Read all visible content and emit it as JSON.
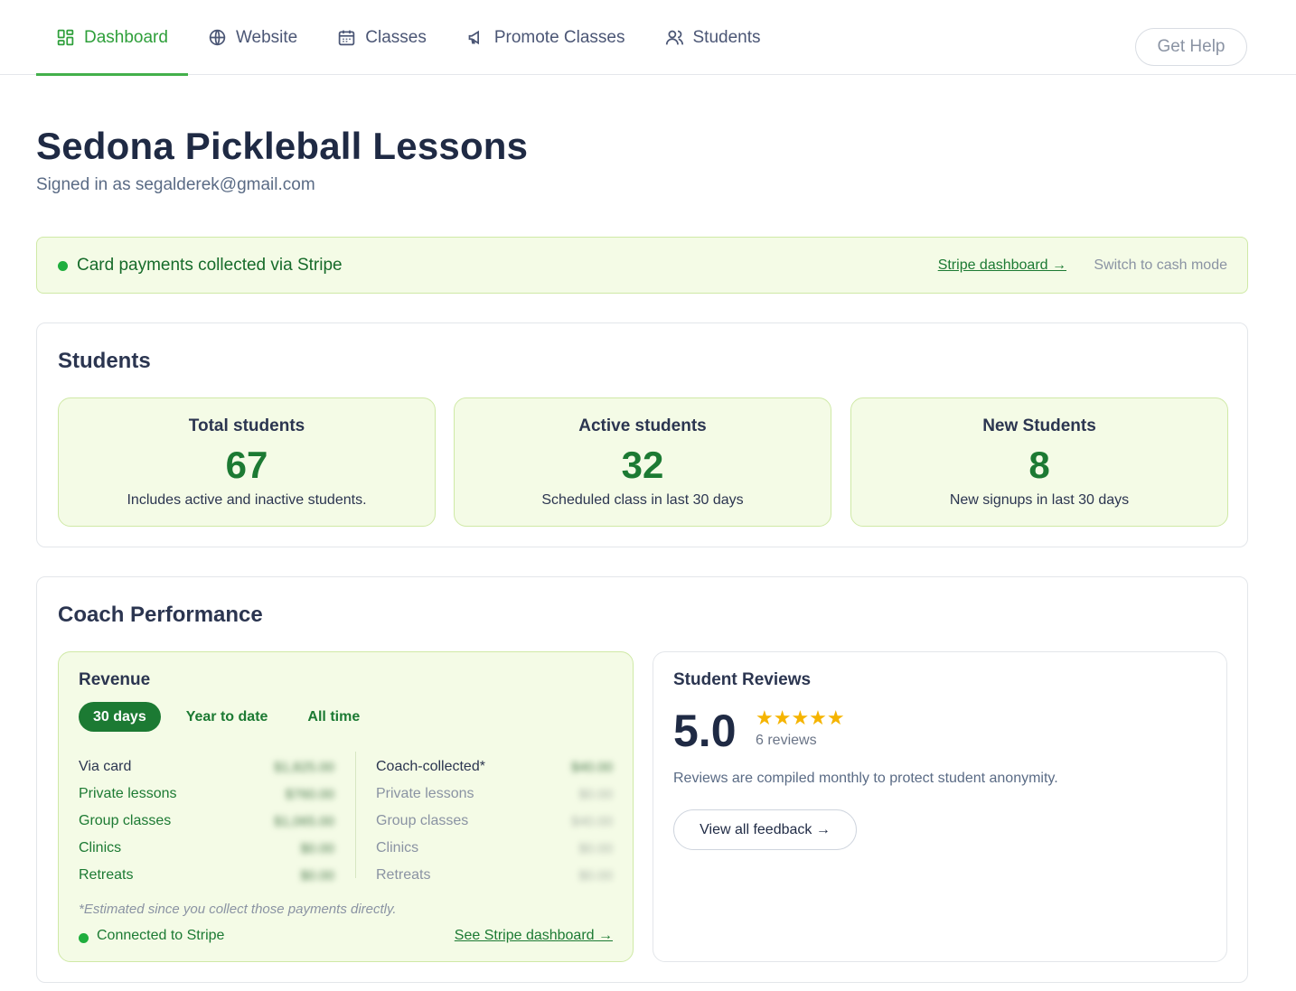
{
  "nav": {
    "tabs": [
      {
        "label": "Dashboard",
        "icon": "dashboard-grid-icon",
        "active": true
      },
      {
        "label": "Website",
        "icon": "globe-icon"
      },
      {
        "label": "Classes",
        "icon": "calendar-icon"
      },
      {
        "label": "Promote Classes",
        "icon": "megaphone-icon"
      },
      {
        "label": "Students",
        "icon": "users-icon"
      }
    ],
    "help_label": "Get Help"
  },
  "header": {
    "title": "Sedona Pickleball Lessons",
    "signed_in": "Signed in as segalderek@gmail.com"
  },
  "banner": {
    "message": "Card payments collected via Stripe",
    "stripe_link": "Stripe dashboard →",
    "cash_mode": "Switch to cash mode"
  },
  "students": {
    "title": "Students",
    "stats": [
      {
        "label": "Total students",
        "value": "67",
        "note": "Includes active and inactive students."
      },
      {
        "label": "Active students",
        "value": "32",
        "note": "Scheduled class in last 30 days"
      },
      {
        "label": "New Students",
        "value": "8",
        "note": "New signups in last 30 days"
      }
    ]
  },
  "performance": {
    "title": "Coach Performance",
    "revenue": {
      "title": "Revenue",
      "periods": [
        "30 days",
        "Year to date",
        "All time"
      ],
      "active_period": "30 days",
      "card": [
        {
          "label": "Via card",
          "value": "$1,825.00"
        },
        {
          "label": "Private lessons",
          "value": "$760.00"
        },
        {
          "label": "Group classes",
          "value": "$1,065.00"
        },
        {
          "label": "Clinics",
          "value": "$0.00"
        },
        {
          "label": "Retreats",
          "value": "$0.00"
        }
      ],
      "coach": [
        {
          "label": "Coach-collected*",
          "value": "$40.00"
        },
        {
          "label": "Private lessons",
          "value": "$0.00"
        },
        {
          "label": "Group classes",
          "value": "$40.00"
        },
        {
          "label": "Clinics",
          "value": "$0.00"
        },
        {
          "label": "Retreats",
          "value": "$0.00"
        }
      ],
      "estimate_note": "*Estimated since you collect those payments directly.",
      "connected": "Connected to Stripe",
      "see_stripe": "See Stripe dashboard →"
    },
    "reviews": {
      "title": "Student Reviews",
      "rating": "5.0",
      "stars": "★★★★★",
      "count": "6 reviews",
      "note": "Reviews are compiled monthly to protect student anonymity.",
      "button": "View all feedback →"
    }
  },
  "colors": {
    "accent": "#2e9f3a",
    "dark_green": "#1c7a33",
    "card_bg": "#f4fbe6",
    "star": "#f5b400"
  }
}
